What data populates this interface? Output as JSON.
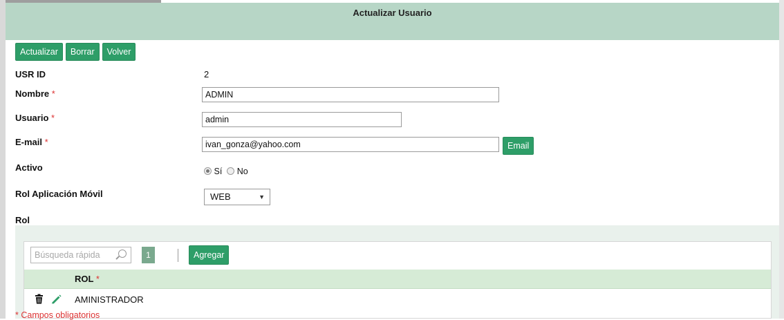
{
  "header": {
    "title": "Actualizar Usuario"
  },
  "toolbar": {
    "update_label": "Actualizar",
    "delete_label": "Borrar",
    "back_label": "Volver"
  },
  "form": {
    "usr_id": {
      "label": "USR ID",
      "value": "2"
    },
    "nombre": {
      "label": "Nombre",
      "required": "*",
      "value": "ADMIN"
    },
    "usuario": {
      "label": "Usuario",
      "required": "*",
      "value": "admin"
    },
    "email": {
      "label": "E-mail",
      "required": "*",
      "value": "ivan_gonza@yahoo.com",
      "button": "Email"
    },
    "activo": {
      "label": "Activo",
      "yes": "Sí",
      "no": "No",
      "selected": "Sí"
    },
    "rol_movil": {
      "label": "Rol Aplicación Móvil",
      "value": "WEB"
    },
    "rol": {
      "label": "Rol"
    }
  },
  "rol_grid": {
    "search_placeholder": "Búsqueda rápida",
    "page": "1",
    "add_label": "Agregar",
    "columns": [
      {
        "label": "ROL",
        "required": "*"
      }
    ],
    "rows": [
      {
        "rol": "AMINISTRADOR"
      }
    ]
  },
  "footer_note": "* Campos obligatorios",
  "colors": {
    "header_bg": "#b7d6c6",
    "button_green": "#2e9e68",
    "grid_header": "#d6ebd6",
    "required_red": "#dd3333"
  }
}
